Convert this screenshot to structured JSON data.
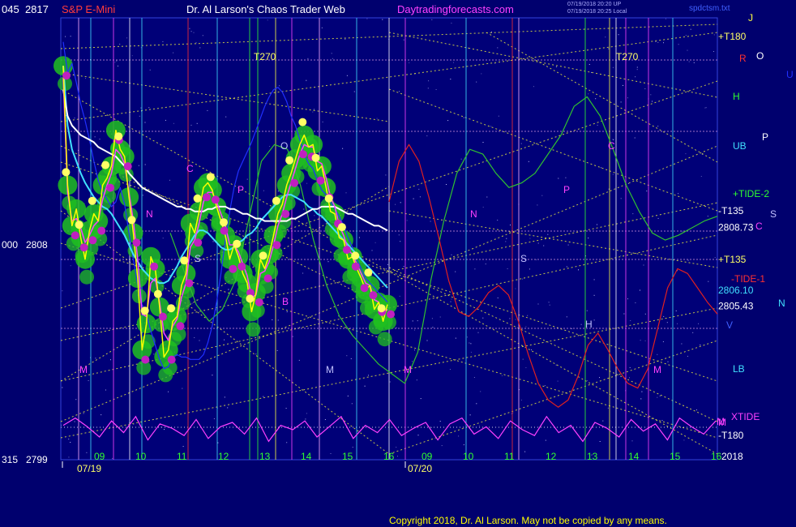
{
  "header": {
    "left_axis_top": "045",
    "right_axis_top": "2817",
    "instrument": "S&P E-Mini",
    "title": "Dr. Al Larson's Chaos Trader Web",
    "site": "Daytradingforecasts.com",
    "timestamp_line1": "07/19/2018 20:20 UP",
    "timestamp_line2": "07/19/2018 20:25 Local",
    "filename": "spdctsm.txt"
  },
  "footer": {
    "copyright": "Copyright 2018, Dr. Al Larson. May not be copied by any means."
  },
  "colors": {
    "background": "#00006e",
    "price_line": "#ffff00",
    "ema_short": "#ff40ff",
    "ema_long": "#ffffff",
    "cyan_line": "#40e0ff",
    "blue_line": "#2030ff",
    "tide_green": "#30c030",
    "tide_red": "#e02020",
    "xtide": "#ff40ff",
    "energy_green": "#20c020",
    "gann_dots": "#ffff66"
  },
  "chart_data": {
    "type": "line",
    "title": "S&P E-Mini",
    "ylim": [
      2799,
      2817
    ],
    "left_axis_labels": [
      {
        "left": "045",
        "right": "2817",
        "value": 2817
      },
      {
        "left": "000",
        "right": "2808",
        "value": 2808
      },
      {
        "left": "315",
        "right": "2799",
        "value": 2799
      }
    ],
    "x_hours_day1": [
      "09",
      "10",
      "11",
      "12",
      "13",
      "14",
      "15",
      "16"
    ],
    "x_hours_day2": [
      "09",
      "10",
      "11",
      "12",
      "13",
      "14",
      "15",
      "16"
    ],
    "dates": [
      "07/19",
      "07/20"
    ],
    "year_label": "2018",
    "price_levels": [
      {
        "label": "2808.73",
        "value": 2808.73
      },
      {
        "label": "2806.10",
        "value": 2806.1
      },
      {
        "label": "2805.43",
        "value": 2805.43
      }
    ],
    "right_labels": [
      "+T180",
      "T270",
      "T270",
      "R",
      "O",
      "J",
      "U",
      "H",
      "UB",
      "P",
      "+TIDE-2",
      "-T135",
      "S",
      "C",
      "+T135",
      "-TIDE-1",
      "N",
      "V",
      "LB",
      "M",
      "XTIDE",
      "-T180"
    ],
    "chart_letter_labels": [
      "N",
      "S",
      "P",
      "C",
      "O",
      "B",
      "M",
      "M",
      "M",
      "N",
      "S",
      "P",
      "C",
      "H",
      "M",
      "M"
    ],
    "series": [
      {
        "name": "price",
        "values": [
          2815.5,
          2810.5,
          2808.8,
          2809.5,
          2808.3,
          2807.4,
          2808.6,
          2809.3,
          2809.0,
          2810.5,
          2810.8,
          2811.3,
          2812.8,
          2812.0,
          2811.7,
          2810.0,
          2808.5,
          2806.6,
          2803.6,
          2804.7,
          2807.5,
          2807.0,
          2805.4,
          2803.3,
          2803.6,
          2804.8,
          2805.0,
          2806.3,
          2806.8,
          2808.9,
          2808.5,
          2809.4,
          2810.4,
          2810.6,
          2810.3,
          2809.6,
          2809.0,
          2808.4,
          2807.4,
          2808.0,
          2807.5,
          2806.8,
          2806.4,
          2805.2,
          2806.0,
          2807.4,
          2807.0,
          2807.6,
          2808.4,
          2809.3,
          2809.7,
          2810.5,
          2811.0,
          2811.6,
          2812.2,
          2812.6,
          2812.1,
          2812.2,
          2811.1,
          2811.3,
          2810.4,
          2809.4,
          2809.3,
          2808.3,
          2808.2,
          2807.4,
          2807.5,
          2807.0,
          2806.6,
          2806.1,
          2806.3,
          2805.3,
          2805.6,
          2804.8,
          2805.5
        ]
      },
      {
        "name": "ema_short",
        "values": [
          2815.0,
          2810.2,
          2809.0,
          2809.1,
          2808.7,
          2808.1,
          2808.4,
          2808.8,
          2809.0,
          2809.9,
          2810.5,
          2811.0,
          2812.0,
          2811.8,
          2811.4,
          2810.2,
          2809.0,
          2807.4,
          2805.1,
          2805.0,
          2806.4,
          2806.6,
          2805.6,
          2804.3,
          2804.0,
          2804.6,
          2804.9,
          2805.8,
          2806.4,
          2807.9,
          2808.2,
          2808.9,
          2809.8,
          2810.2,
          2810.2,
          2809.8,
          2809.3,
          2808.8,
          2808.0,
          2808.0,
          2807.7,
          2807.2,
          2806.7,
          2805.8,
          2805.9,
          2806.8,
          2806.9,
          2807.3,
          2808.0,
          2808.8,
          2809.3,
          2810.0,
          2810.6,
          2811.2,
          2811.8,
          2812.2,
          2812.1,
          2812.1,
          2811.5,
          2811.4,
          2810.8,
          2810.0,
          2809.6,
          2808.8,
          2808.4,
          2807.8,
          2807.6,
          2807.2,
          2806.8,
          2806.4,
          2806.3,
          2805.7,
          2805.6,
          2805.1,
          2805.3
        ]
      },
      {
        "name": "ema_long",
        "values": [
          2814.5,
          2813.4,
          2813.0,
          2812.8,
          2812.6,
          2812.5,
          2812.4,
          2812.3,
          2812.1,
          2812.0,
          2811.9,
          2811.8,
          2811.7,
          2811.5,
          2811.3,
          2811.0,
          2810.8,
          2810.6,
          2810.4,
          2810.3,
          2810.2,
          2810.1,
          2810.0,
          2809.9,
          2809.8,
          2809.7,
          2809.6,
          2809.6,
          2809.5,
          2809.5,
          2809.4,
          2809.4,
          2809.4,
          2809.5,
          2809.5,
          2809.6,
          2809.6,
          2809.6,
          2809.5,
          2809.5,
          2809.4,
          2809.3,
          2809.3,
          2809.2,
          2809.1,
          2809.1,
          2809.0,
          2809.0,
          2809.0,
          2809.0,
          2809.0,
          2809.0,
          2809.1,
          2809.1,
          2809.2,
          2809.3,
          2809.4,
          2809.5,
          2809.5,
          2809.6,
          2809.6,
          2809.6,
          2809.6,
          2809.5,
          2809.4,
          2809.3,
          2809.3,
          2809.2,
          2809.1,
          2809.0,
          2808.9,
          2808.8,
          2808.8,
          2808.7,
          2808.6
        ]
      },
      {
        "name": "cyan",
        "values": [
          2815.5,
          2813.0,
          2812.0,
          2811.5,
          2811.0,
          2810.6,
          2810.3,
          2810.0,
          2809.8,
          2809.6,
          2809.5,
          2809.3,
          2809.0,
          2808.7,
          2808.4,
          2808.0,
          2807.6,
          2807.3,
          2807.0,
          2806.8,
          2806.6,
          2806.5,
          2806.4,
          2806.4,
          2806.5,
          2806.8,
          2807.1,
          2807.5,
          2807.8,
          2808.1,
          2808.4,
          2808.6,
          2808.6,
          2808.5,
          2808.3,
          2808.1,
          2807.9,
          2807.8,
          2807.8,
          2807.9,
          2808.1,
          2808.2,
          2808.4,
          2808.5,
          2808.7,
          2809.0,
          2809.2,
          2809.4,
          2809.6,
          2809.8,
          2810.0,
          2810.1,
          2810.1,
          2810.0,
          2809.9,
          2809.8,
          2809.6,
          2809.5,
          2809.3,
          2809.2,
          2809.0,
          2808.8,
          2808.6,
          2808.4,
          2808.2,
          2808.0,
          2807.8,
          2807.6,
          2807.4,
          2807.2,
          2807.0,
          2806.8,
          2806.6,
          2806.4,
          2806.2
        ]
      },
      {
        "name": "blue",
        "values": [
          2816.5,
          2815.2,
          2815.6,
          2814.8,
          2813.9,
          2813.2,
          2812.4,
          2811.5,
          2810.7,
          2810.2,
          2809.9,
          2809.6,
          2809.8,
          2810.4,
          2809.7,
          2808.5,
          2807.4,
          2806.3,
          2805.5,
          2805.1,
          2804.4,
          2803.8,
          2803.2,
          2802.8,
          2802.9,
          2803.3,
          2803.4,
          2803.3,
          2803.3,
          2803.2,
          2803.2,
          2803.2,
          2803.4,
          2803.9,
          2804.6,
          2805.6,
          2806.8,
          2808.2,
          2809.4,
          2810.4,
          2811.1,
          2811.5,
          2811.9,
          2812.3,
          2812.8,
          2813.3,
          2813.8,
          2814.2,
          2814.5,
          2814.6,
          2814.4,
          2814.0,
          2813.4,
          2813.0,
          2812.4,
          2811.8,
          2811.4,
          2811.2,
          2810.7,
          2810.3,
          2810.1,
          2809.8,
          2809.5,
          2809.2,
          2808.8,
          2808.3,
          2807.9,
          2807.4,
          2807.0,
          2806.6,
          2806.4,
          2806.2,
          2806.0,
          2805.8,
          2805.6
        ]
      }
    ],
    "tides": [
      {
        "name": "+TIDE-2",
        "values": [
          2808.5,
          2807.0,
          2805.5,
          2804.8,
          2805.3,
          2806.5,
          2809.0,
          2811.5,
          2812.2,
          2812.0,
          2810.5,
          2808.2,
          2806.3,
          2805.0,
          2804.2,
          2803.6,
          2803.0,
          2802.6,
          2802.2,
          2803.5,
          2806.5,
          2809.0,
          2811.0,
          2812.0,
          2811.8,
          2811.0,
          2810.4,
          2810.6,
          2811.0,
          2811.8,
          2812.6,
          2813.8,
          2814.2,
          2813.4,
          2812.0,
          2810.5,
          2809.4,
          2808.5,
          2808.2,
          2808.4,
          2808.7,
          2809.0,
          2809.2
        ]
      },
      {
        "name": "-TIDE-1",
        "values": [
          2809.8,
          2811.5,
          2812.2,
          2811.5,
          2810.0,
          2808.3,
          2806.5,
          2805.2,
          2805.0,
          2805.4,
          2806.0,
          2806.3,
          2805.9,
          2804.8,
          2803.4,
          2802.2,
          2801.5,
          2801.2,
          2801.5,
          2802.5,
          2803.8,
          2804.3,
          2803.6,
          2802.8,
          2802.2,
          2802.0,
          2802.8,
          2804.5,
          2806.2,
          2807.0,
          2806.8,
          2806.2,
          2805.6,
          2805.1
        ]
      },
      {
        "name": "XTIDE",
        "values": [
          0.3,
          0.8,
          0.2,
          -0.5,
          0.6,
          -0.2,
          0.9,
          -0.7,
          0.4,
          0.1,
          -0.4,
          0.7,
          -0.6,
          0.2,
          0.5,
          -0.3,
          0.8,
          -0.8,
          0.3,
          0.0,
          0.6,
          -0.5,
          0.2,
          0.9,
          -0.6,
          0.3,
          -0.2,
          0.7,
          -0.4,
          0.1,
          0.5,
          -0.7,
          0.4,
          0.8,
          -0.3,
          0.2,
          -0.6,
          0.6,
          0.0,
          -0.4,
          0.9,
          -0.2,
          0.3,
          -0.8,
          0.5,
          0.1,
          -0.5,
          0.7,
          -0.1,
          0.4,
          -0.7,
          0.8,
          0.2,
          -0.3,
          0.6
        ]
      }
    ]
  }
}
